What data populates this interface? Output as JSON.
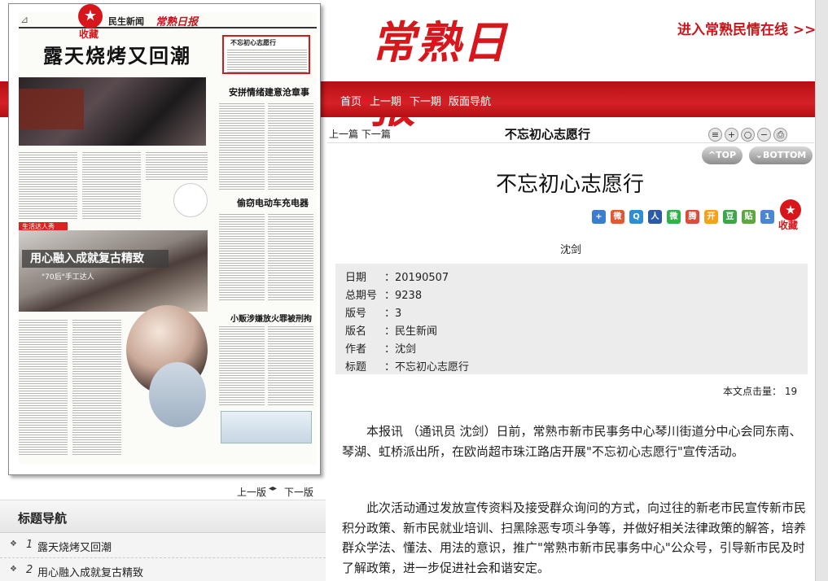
{
  "header": {
    "masthead": "常熟日报",
    "online_link": "进入常熟民情在线 >>",
    "nav": [
      "首页",
      "上一期",
      "下一期",
      "版面导航"
    ]
  },
  "paper": {
    "bookmark_label": "收藏",
    "section": "民生新闻",
    "logo": "常熟日报",
    "headline": "露天烧烤又回潮",
    "highlight_title": "不忘初心志愿行",
    "sub_head_1": "安拼情绪建意沧章事",
    "sub_head_2": "偷窃电动车充电器",
    "sub_head_3": "小贩涉嫌放火罪被刑拘",
    "tag": "生活达人秀",
    "photo_banner": "用心融入成就复古精致",
    "photo_sub": "\"70后\"手工达人"
  },
  "page_turn": {
    "prev": "上一版",
    "next": "下一版"
  },
  "title_nav": {
    "title": "标题导航",
    "items": [
      {
        "num": "1",
        "text": "露天烧烤又回潮"
      },
      {
        "num": "2",
        "text": "用心融入成就复古精致"
      }
    ]
  },
  "article": {
    "prev_next": "上一篇 下一篇",
    "toolbar_title": "不忘初心志愿行",
    "top_btn": "TOP",
    "bottom_btn": "BOTTOM",
    "title": "不忘初心志愿行",
    "collect_label": "收藏",
    "author": "沈剑",
    "meta": [
      {
        "k": "日期",
        "v": "20190507"
      },
      {
        "k": "总期号",
        "v": "9238"
      },
      {
        "k": "版号",
        "v": "3"
      },
      {
        "k": "版名",
        "v": "民生新闻"
      },
      {
        "k": "作者",
        "v": "沈剑"
      },
      {
        "k": "标题",
        "v": "不忘初心志愿行"
      }
    ],
    "hits_label": "本文点击量：",
    "hits_value": "19",
    "paragraphs": [
      "本报讯 （通讯员 沈剑）日前，常熟市新市民事务中心琴川街道分中心会同东南、琴湖、虹桥派出所，在欧尚超市珠江路店开展\"不忘初心志愿行\"宣传活动。",
      "此次活动通过发放宣传资料及接受群众询问的方式，向过往的新老市民宣传新市民积分政策、新市民就业培训、扫黑除恶专项斗争等，并做好相关法律政策的解答，培养群众学法、懂法、用法的意识，推广\"常熟市新市民事务中心\"公众号，引导新市民及时了解政策，进一步促进社会和谐安定。"
    ]
  },
  "colors": {
    "brand_red": "#d7161c",
    "nav_red": "#c8161d"
  }
}
